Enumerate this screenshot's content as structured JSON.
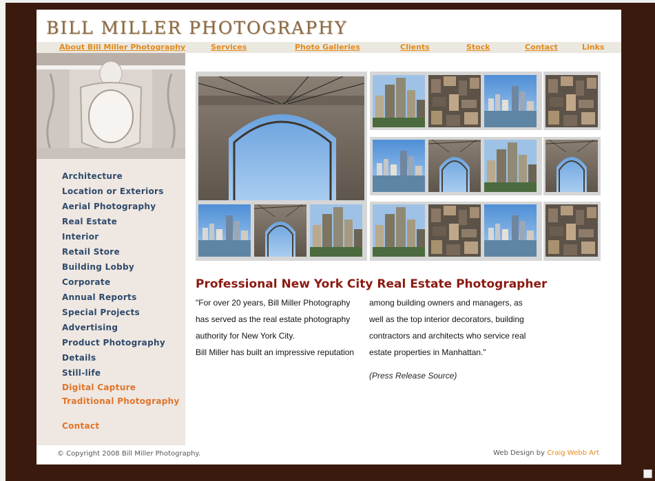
{
  "brand": {
    "title": "BILL MILLER PHOTOGRAPHY"
  },
  "nav": {
    "items": [
      "About Bill Miller Photography",
      "Services",
      "Photo Galleries",
      "Clients",
      "Stock",
      "Contact",
      "Links"
    ]
  },
  "sidebar": {
    "links": [
      "Architecture",
      "Location or Exteriors",
      "Aerial Photography",
      "Real Estate",
      "Interior",
      "Retail Store",
      "Building Lobby",
      "Corporate",
      "Annual Reports",
      "Special Projects",
      "Advertising",
      "Product Photography",
      "Details",
      "Still-life",
      "Digital Capture",
      "Traditional Photography",
      "Contact"
    ]
  },
  "main": {
    "headline": "Professional New York City Real Estate Photographer",
    "col1": {
      "line1": "\"For over 20 years, Bill Miller Photography",
      "line2": "has served as the real estate photography",
      "line3": "authority for New York City.",
      "line4": "Bill Miller has built an impressive reputation"
    },
    "col2": {
      "line1": "among building owners and managers, as",
      "line2": "well as the top interior decorators, building",
      "line3": "contractors and architects who service real",
      "line4": "estate properties in Manhattan.\""
    },
    "source": "(Press Release Source)"
  },
  "footer": {
    "copyright": "© Copyright 2008 Bill Miller Photography.",
    "design_prefix": "Web Design by ",
    "design_link": "Craig Webb Art"
  },
  "colors": {
    "frame": "#3a1a0f",
    "nav_link": "#e28a1a",
    "sidebar_link": "#2e4a6a",
    "headline": "#8b1a12"
  }
}
